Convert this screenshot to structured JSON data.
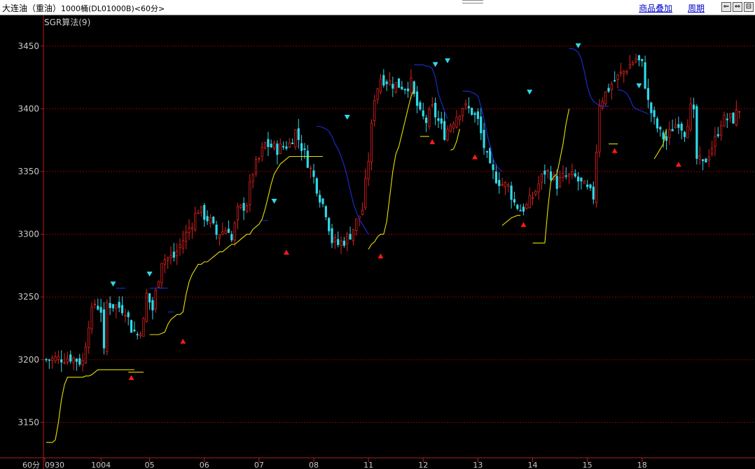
{
  "header": {
    "title_main": "大连油（重油）",
    "title_detail": "1000桶(DL01000B)<60分>",
    "links": [
      "商品叠加",
      "周期"
    ],
    "buttons": [
      "⇐",
      "⇔",
      "⊟"
    ]
  },
  "indicator_label": "SGR算法(9)",
  "colors": {
    "background": "#000000",
    "grid": "#8b0000",
    "up": "#e02020",
    "down": "#30d8e8",
    "support": "#e8e000",
    "resistance": "#1a2fd8",
    "axis_text": "#c8c8c8"
  },
  "chart_data": {
    "type": "candlestick",
    "period_label": "60分",
    "ylim": [
      3124,
      3470
    ],
    "yticks": [
      3150,
      3200,
      3250,
      3300,
      3350,
      3400,
      3450
    ],
    "xticks": [
      {
        "label": "0930",
        "index": 0
      },
      {
        "label": "1004",
        "index": 18
      },
      {
        "label": "05",
        "index": 34
      },
      {
        "label": "06",
        "index": 52
      },
      {
        "label": "07",
        "index": 70
      },
      {
        "label": "08",
        "index": 88
      },
      {
        "label": "11",
        "index": 106
      },
      {
        "label": "12",
        "index": 124
      },
      {
        "label": "13",
        "index": 142
      },
      {
        "label": "14",
        "index": 160
      },
      {
        "label": "15",
        "index": 178
      },
      {
        "label": "18",
        "index": 196
      }
    ],
    "price_path": [
      [
        0,
        3200
      ],
      [
        8,
        3202
      ],
      [
        12,
        3198
      ],
      [
        14,
        3230
      ],
      [
        16,
        3245
      ],
      [
        18,
        3240
      ],
      [
        19,
        3205
      ],
      [
        20,
        3245
      ],
      [
        24,
        3242
      ],
      [
        26,
        3240
      ],
      [
        28,
        3225
      ],
      [
        30,
        3220
      ],
      [
        32,
        3230
      ],
      [
        33,
        3252
      ],
      [
        35,
        3240
      ],
      [
        38,
        3280
      ],
      [
        42,
        3282
      ],
      [
        46,
        3300
      ],
      [
        50,
        3320
      ],
      [
        54,
        3310
      ],
      [
        56,
        3300
      ],
      [
        60,
        3305
      ],
      [
        61,
        3295
      ],
      [
        63,
        3318
      ],
      [
        66,
        3325
      ],
      [
        68,
        3350
      ],
      [
        70,
        3360
      ],
      [
        72,
        3372
      ],
      [
        76,
        3368
      ],
      [
        80,
        3372
      ],
      [
        82,
        3382
      ],
      [
        84,
        3370
      ],
      [
        86,
        3358
      ],
      [
        88,
        3345
      ],
      [
        90,
        3330
      ],
      [
        92,
        3318
      ],
      [
        94,
        3295
      ],
      [
        96,
        3292
      ],
      [
        98,
        3295
      ],
      [
        100,
        3300
      ],
      [
        102,
        3310
      ],
      [
        104,
        3320
      ],
      [
        106,
        3360
      ],
      [
        108,
        3410
      ],
      [
        110,
        3425
      ],
      [
        114,
        3420
      ],
      [
        118,
        3418
      ],
      [
        120,
        3420
      ],
      [
        121,
        3410
      ],
      [
        123,
        3395
      ],
      [
        125,
        3390
      ],
      [
        127,
        3400
      ],
      [
        129,
        3390
      ],
      [
        131,
        3380
      ],
      [
        133,
        3388
      ],
      [
        135,
        3395
      ],
      [
        137,
        3402
      ],
      [
        140,
        3398
      ],
      [
        142,
        3390
      ],
      [
        144,
        3370
      ],
      [
        146,
        3352
      ],
      [
        148,
        3345
      ],
      [
        150,
        3340
      ],
      [
        152,
        3338
      ],
      [
        154,
        3325
      ],
      [
        156,
        3320
      ],
      [
        158,
        3322
      ],
      [
        160,
        3330
      ],
      [
        162,
        3340
      ],
      [
        164,
        3350
      ],
      [
        166,
        3348
      ],
      [
        168,
        3340
      ],
      [
        170,
        3345
      ],
      [
        172,
        3346
      ],
      [
        174,
        3345
      ],
      [
        176,
        3340
      ],
      [
        178,
        3335
      ],
      [
        180,
        3330
      ],
      [
        182,
        3405
      ],
      [
        186,
        3420
      ],
      [
        190,
        3430
      ],
      [
        194,
        3440
      ],
      [
        196,
        3435
      ],
      [
        198,
        3405
      ],
      [
        200,
        3390
      ],
      [
        202,
        3380
      ],
      [
        204,
        3375
      ],
      [
        206,
        3385
      ],
      [
        208,
        3390
      ],
      [
        210,
        3382
      ],
      [
        212,
        3400
      ],
      [
        213,
        3395
      ],
      [
        214,
        3360
      ],
      [
        216,
        3355
      ],
      [
        218,
        3365
      ],
      [
        220,
        3375
      ],
      [
        222,
        3390
      ],
      [
        224,
        3392
      ],
      [
        226,
        3392
      ],
      [
        228,
        3400
      ]
    ],
    "resistance_segments": [
      {
        "from": 23,
        "to": 26,
        "value": 3257
      },
      {
        "from": 34,
        "to": 40,
        "value": 3257
      },
      {
        "from": 40,
        "to": 42,
        "value": 3238
      },
      {
        "from": 71,
        "to": 73,
        "value": 3311
      },
      {
        "from": 89,
        "to": 106,
        "path": [
          3386,
          3386,
          3385,
          3384,
          3382,
          3378,
          3372,
          3368,
          3362,
          3355,
          3346,
          3335,
          3325,
          3318,
          3312,
          3308,
          3304,
          3300
        ]
      },
      {
        "from": 121,
        "to": 132,
        "path": [
          3435,
          3435,
          3435,
          3435,
          3434,
          3434,
          3432,
          3425,
          3412,
          3405,
          3398,
          3392
        ]
      },
      {
        "from": 137,
        "to": 150,
        "path": [
          3414,
          3414,
          3414,
          3413,
          3412,
          3410,
          3402,
          3392,
          3380,
          3370,
          3360,
          3355,
          3352,
          3350
        ]
      },
      {
        "from": 172,
        "to": 185,
        "path": [
          3448,
          3448,
          3447,
          3445,
          3440,
          3430,
          3418,
          3410,
          3406,
          3404,
          3403,
          3402,
          3402,
          3402
        ]
      },
      {
        "from": 188,
        "to": 198,
        "path": [
          3415,
          3415,
          3414,
          3412,
          3408,
          3402,
          3400,
          3399,
          3398,
          3397,
          3396
        ]
      }
    ],
    "support_segments": [
      {
        "from": 0,
        "to": 29,
        "path": [
          3134,
          3134,
          3134,
          3136,
          3150,
          3168,
          3180,
          3186,
          3186,
          3186,
          3186,
          3186,
          3186,
          3187,
          3187,
          3188,
          3190,
          3192,
          3192,
          3192,
          3192,
          3192,
          3192,
          3192,
          3192,
          3192,
          3192,
          3192,
          3192,
          3192
        ]
      },
      {
        "from": 27,
        "to": 32,
        "value": 3190
      },
      {
        "from": 34,
        "to": 91,
        "path": [
          3220,
          3220,
          3220,
          3220,
          3221,
          3222,
          3228,
          3232,
          3234,
          3236,
          3236,
          3238,
          3252,
          3262,
          3268,
          3272,
          3276,
          3276,
          3278,
          3278,
          3280,
          3282,
          3284,
          3286,
          3286,
          3288,
          3290,
          3292,
          3292,
          3294,
          3296,
          3298,
          3300,
          3300,
          3304,
          3306,
          3308,
          3312,
          3320,
          3330,
          3340,
          3348,
          3352,
          3356,
          3358,
          3360,
          3362,
          3362,
          3362,
          3362,
          3362,
          3362,
          3362,
          3362,
          3362,
          3362,
          3362,
          3362
        ]
      },
      {
        "from": 106,
        "to": 121,
        "path": [
          3288,
          3292,
          3294,
          3298,
          3300,
          3300,
          3310,
          3330,
          3350,
          3364,
          3370,
          3380,
          3390,
          3400,
          3410,
          3415
        ]
      },
      {
        "from": 123,
        "to": 126,
        "value": 3378
      },
      {
        "from": 133,
        "to": 136,
        "path": [
          3367,
          3368,
          3374,
          3384
        ]
      },
      {
        "from": 150,
        "to": 156,
        "path": [
          3307,
          3309,
          3311,
          3313,
          3314,
          3315,
          3315
        ]
      },
      {
        "from": 160,
        "to": 164,
        "value": 3293
      },
      {
        "from": 164,
        "to": 172,
        "path": [
          3293,
          3320,
          3342,
          3346,
          3348,
          3360,
          3372,
          3388,
          3400
        ]
      },
      {
        "from": 185,
        "to": 188,
        "value": 3372
      },
      {
        "from": 200,
        "to": 204,
        "path": [
          3360,
          3364,
          3368,
          3372,
          3384
        ]
      }
    ],
    "sell_markers": [
      {
        "index": 22,
        "price": 3260
      },
      {
        "index": 34,
        "price": 3268
      },
      {
        "index": 75,
        "price": 3326
      },
      {
        "index": 99,
        "price": 3393
      },
      {
        "index": 128,
        "price": 3435
      },
      {
        "index": 132,
        "price": 3438
      },
      {
        "index": 159,
        "price": 3413
      },
      {
        "index": 175,
        "price": 3450
      },
      {
        "index": 195,
        "price": 3418
      }
    ],
    "buy_markers": [
      {
        "index": 28,
        "price": 3186
      },
      {
        "index": 45,
        "price": 3215
      },
      {
        "index": 79,
        "price": 3286
      },
      {
        "index": 110,
        "price": 3283
      },
      {
        "index": 127,
        "price": 3374
      },
      {
        "index": 141,
        "price": 3362
      },
      {
        "index": 157,
        "price": 3308
      },
      {
        "index": 187,
        "price": 3367
      },
      {
        "index": 208,
        "price": 3356
      }
    ]
  }
}
